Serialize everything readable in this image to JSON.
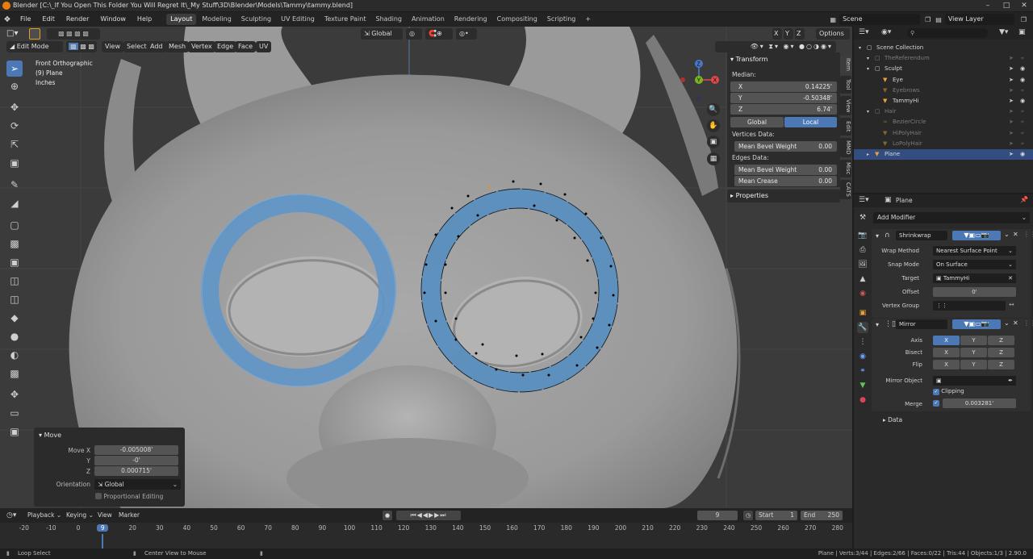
{
  "window": {
    "title": "Blender [C:\\_If You Open This Folder You Will Regret It\\_My Stuff\\3D\\Blender\\Models\\Tammy\\tammy.blend]"
  },
  "menubar": {
    "menus": [
      "File",
      "Edit",
      "Render",
      "Window",
      "Help"
    ],
    "workspaces": [
      "Layout",
      "Modeling",
      "Sculpting",
      "UV Editing",
      "Texture Paint",
      "Shading",
      "Animation",
      "Rendering",
      "Compositing",
      "Scripting"
    ],
    "active_workspace": "Layout",
    "add_tab": "+",
    "scene": "Scene",
    "view_layer": "View Layer"
  },
  "viewport_header": {
    "mode": "Edit Mode",
    "menus": [
      "View",
      "Select",
      "Add",
      "Mesh",
      "Vertex",
      "Edge",
      "Face",
      "UV"
    ],
    "orientation": "Global",
    "axes": [
      "X",
      "Y",
      "Z"
    ],
    "options": "Options"
  },
  "viewport_info": {
    "view": "Front Orthographic",
    "object": "(9) Plane",
    "units": "Inches"
  },
  "gizmo": {
    "z": "Z",
    "y": "Y",
    "x": "X"
  },
  "npanel": {
    "transform_title": "Transform",
    "median_label": "Median:",
    "fields": [
      {
        "label": "X",
        "value": "0.14225'"
      },
      {
        "label": "Y",
        "value": "-0.50348'"
      },
      {
        "label": "Z",
        "value": "6.74'"
      }
    ],
    "space_global": "Global",
    "space_local": "Local",
    "vertices_label": "Vertices Data:",
    "vert_bevel": {
      "label": "Mean Bevel Weight",
      "value": "0.00"
    },
    "edges_label": "Edges Data:",
    "edge_bevel": {
      "label": "Mean Bevel Weight",
      "value": "0.00"
    },
    "edge_crease": {
      "label": "Mean Crease",
      "value": "0.00"
    },
    "properties_title": "Properties",
    "tabs": [
      "Item",
      "Tool",
      "View",
      "Edit",
      "MMD",
      "Misc",
      "CATS"
    ]
  },
  "move_panel": {
    "title": "Move",
    "move_x": {
      "label": "Move X",
      "value": "-0.005008'"
    },
    "move_y": {
      "label": "Y",
      "value": "-0'"
    },
    "move_z": {
      "label": "Z",
      "value": "0.000715'"
    },
    "orientation": {
      "label": "Orientation",
      "value": "Global"
    },
    "proportional": "Proportional Editing"
  },
  "timeline": {
    "menus": [
      "Playback",
      "Keying",
      "View",
      "Marker"
    ],
    "current_frame": "9",
    "start_label": "Start",
    "start": "1",
    "end_label": "End",
    "end": "250",
    "ruler": [
      "-20",
      "-10",
      "0",
      "9",
      "20",
      "30",
      "40",
      "50",
      "60",
      "70",
      "80",
      "90",
      "100",
      "110",
      "120",
      "130",
      "140",
      "150",
      "160",
      "170",
      "180",
      "190",
      "200",
      "210",
      "220",
      "230",
      "240",
      "250",
      "260",
      "270",
      "280"
    ]
  },
  "outliner": {
    "search_placeholder": "",
    "items": [
      {
        "name": "Scene Collection",
        "icon": "collection-icon",
        "indent": 0,
        "dim": false
      },
      {
        "name": "TheReferendum",
        "icon": "collection-icon",
        "indent": 1,
        "dim": true
      },
      {
        "name": "Sculpt",
        "icon": "collection-icon",
        "indent": 1,
        "dim": false
      },
      {
        "name": "Eye",
        "icon": "mesh-icon",
        "indent": 2,
        "dim": false
      },
      {
        "name": "Eyebrows",
        "icon": "mesh-icon",
        "indent": 2,
        "dim": true
      },
      {
        "name": "TammyHi",
        "icon": "mesh-icon",
        "indent": 2,
        "dim": false
      },
      {
        "name": "Hair",
        "icon": "collection-icon",
        "indent": 1,
        "dim": true
      },
      {
        "name": "BezierCircle",
        "icon": "curve-icon",
        "indent": 2,
        "dim": true
      },
      {
        "name": "HiPolyHair",
        "icon": "mesh-icon",
        "indent": 2,
        "dim": true
      },
      {
        "name": "LoPolyHair",
        "icon": "mesh-icon",
        "indent": 2,
        "dim": true
      },
      {
        "name": "Plane",
        "icon": "mesh-icon",
        "indent": 1,
        "dim": false
      }
    ]
  },
  "properties": {
    "object_name": "Plane",
    "add_modifier": "Add Modifier",
    "shrinkwrap": {
      "name": "Shrinkwrap",
      "wrap_method_label": "Wrap Method",
      "wrap_method": "Nearest Surface Point",
      "snap_mode_label": "Snap Mode",
      "snap_mode": "On Surface",
      "target_label": "Target",
      "target": "TammyHi",
      "offset_label": "Offset",
      "offset": "0'",
      "vertex_group_label": "Vertex Group"
    },
    "mirror": {
      "name": "Mirror",
      "axis_label": "Axis",
      "bisect_label": "Bisect",
      "flip_label": "Flip",
      "axes": [
        "X",
        "Y",
        "Z"
      ],
      "mirror_object_label": "Mirror Object",
      "clipping": "Clipping",
      "merge_label": "Merge",
      "merge_value": "0.003281'"
    },
    "data_label": "Data"
  },
  "statusbar": {
    "left1": "Loop Select",
    "left2": "Center View to Mouse",
    "stats": "Plane | Verts:3/44 | Edges:2/66 | Faces:0/22 | Tris:44 | Objects:1/3 | 2.90.0"
  },
  "colors": {
    "accent": "#4d78b6",
    "mesh_face": "#5a8fbf",
    "header": "#232323",
    "panel": "#2c2c2c"
  }
}
